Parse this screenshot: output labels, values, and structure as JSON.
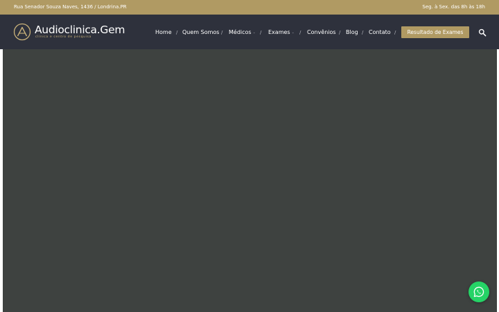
{
  "topbar": {
    "address": "Rua Senador Souza Naves, 1436 / Londrina.PR",
    "hours": "Seg. à Sex. das 8h às 18h"
  },
  "brand": {
    "name": "Audioclinica.Gem",
    "tagline": "clínica e centro de pesquisa",
    "logo_icon": "delta-letter-a-logo-icon"
  },
  "nav": {
    "items": [
      {
        "label": "Home"
      },
      {
        "label": "Quem Somos"
      },
      {
        "label": "Médicos",
        "has_dropdown": true
      },
      {
        "label": "Exames",
        "has_dropdown": true
      },
      {
        "label": "Convênios"
      },
      {
        "label": "Blog"
      },
      {
        "label": "Contato"
      }
    ],
    "separator": "/",
    "caret": "⌄",
    "cta_label": "Resultado de Exames",
    "search_icon": "search-icon"
  },
  "whatsapp": {
    "icon": "whatsapp-icon"
  },
  "colors": {
    "topbar_bg": "#b09a63",
    "navbar_bg": "#2e313c",
    "accent_gold": "#b09a63",
    "hero_bg": "#3e4240",
    "whatsapp_green": "#25d366"
  }
}
